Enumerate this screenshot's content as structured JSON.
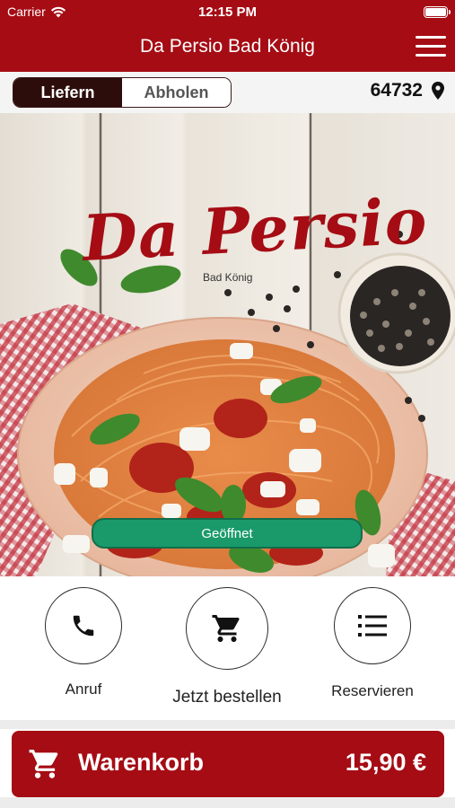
{
  "statusbar": {
    "carrier": "Carrier",
    "time": "12:15 PM",
    "icons": [
      "wifi-icon",
      "battery-icon"
    ]
  },
  "navbar": {
    "title": "Da Persio Bad König",
    "menu_icon": "hamburger-menu-icon"
  },
  "mode": {
    "delivery_label": "Liefern",
    "pickup_label": "Abholen",
    "selected": "Liefern",
    "postal_code": "64732",
    "location_icon": "location-pin-icon"
  },
  "hero": {
    "logo_text": "Da Persio",
    "logo_subtitle": "Bad König",
    "status_label": "Geöffnet",
    "status_color": "#1a9a6a"
  },
  "actions": [
    {
      "label": "Anruf",
      "icon": "phone-icon"
    },
    {
      "label": "Jetzt bestellen",
      "icon": "cart-icon"
    },
    {
      "label": "Reservieren",
      "icon": "list-icon"
    }
  ],
  "cart": {
    "label": "Warenkorb",
    "total": "15,90 €",
    "icon": "cart-icon"
  },
  "colors": {
    "brand": "#a50c14",
    "segment_active": "#2d0d0c",
    "open_green": "#1a9a6a"
  }
}
